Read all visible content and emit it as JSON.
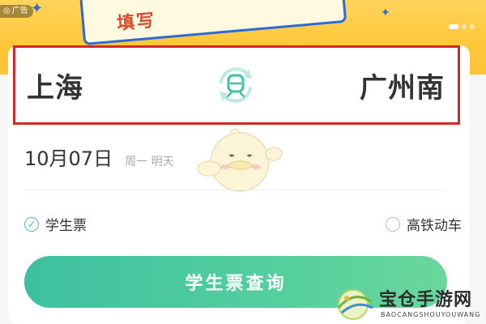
{
  "banner": {
    "ad_label": "广告",
    "headline": "填写",
    "dots": 3,
    "active_dot": 0
  },
  "route": {
    "from": "上海",
    "to": "广州南",
    "swap_icon": "train-swap-icon"
  },
  "date": {
    "value": "10月07日",
    "weekday": "周一 明天"
  },
  "options": {
    "student": {
      "label": "学生票",
      "checked": true
    },
    "high_speed": {
      "label": "高铁动车",
      "checked": false
    }
  },
  "query_button": {
    "label": "学生票查询"
  },
  "watermark": {
    "title": "宝仓手游网",
    "subtitle": "BAOCANGSHOUYOUWANG"
  },
  "colors": {
    "accent": "#3cc2a4",
    "highlight_box": "#d7262a",
    "banner_bg": "#ffc83a"
  }
}
